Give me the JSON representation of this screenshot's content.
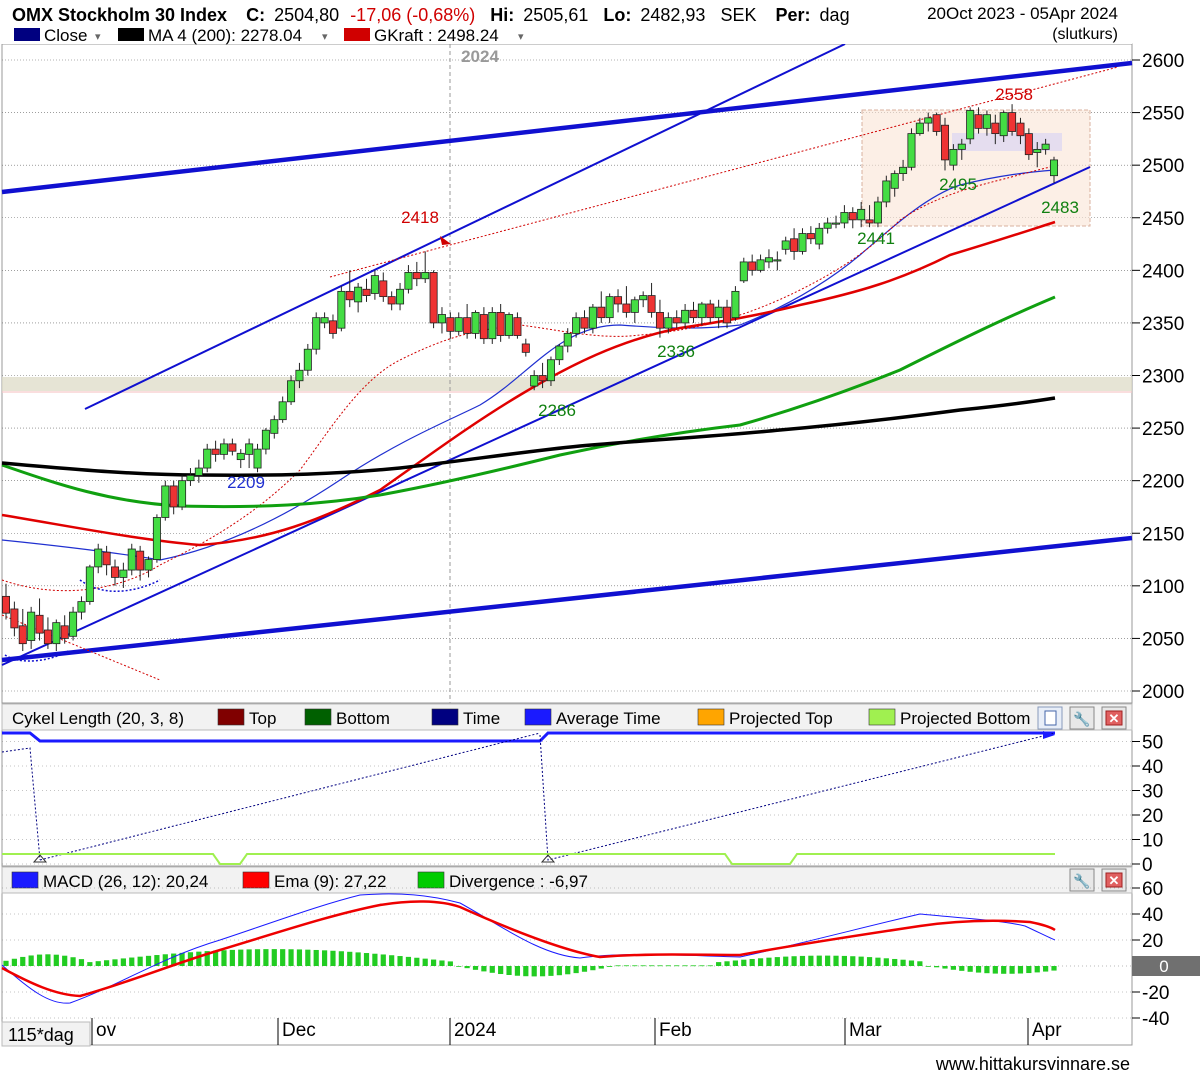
{
  "header": {
    "index_name": "OMX Stockholm 30 Index",
    "close_label": "C:",
    "close_value": "2504,80",
    "change": "-17,06 (-0,68%)",
    "hi_label": "Hi:",
    "hi_value": "2505,61",
    "lo_label": "Lo:",
    "lo_value": "2482,93",
    "currency": "SEK",
    "period_label": "Per:",
    "period_value": "dag",
    "date_range": "20Oct 2023 - 05Apr 2024",
    "price_basis": "(slutkurs)"
  },
  "legend": [
    {
      "label": "Close",
      "color": "#000080",
      "dropdown": true
    },
    {
      "label": "MA 4 (200): 2278.04",
      "color": "#000000",
      "dropdown": true
    },
    {
      "label": "GKraft : 2498.24",
      "color": "#d00000",
      "dropdown": true
    }
  ],
  "year_marker": "2024",
  "annotations": {
    "price_2418": "2418",
    "price_2558": "2558",
    "price_2495": "2495",
    "price_2483": "2483",
    "price_2441": "2441",
    "price_2336": "2336",
    "price_2286": "2286",
    "price_2209": "2209"
  },
  "cycle_panel": {
    "title": "Cykel Length (20, 3, 8)",
    "legend": [
      {
        "label": "Top",
        "color": "#800000"
      },
      {
        "label": "Bottom",
        "color": "#006000"
      },
      {
        "label": "Time",
        "color": "#000080"
      },
      {
        "label": "Average Time",
        "color": "#1a1aff"
      },
      {
        "label": "Projected Top",
        "color": "#ffa500"
      },
      {
        "label": "Projected Bottom",
        "color": "#a0f050"
      }
    ],
    "y_ticks": [
      "50",
      "40",
      "30",
      "20",
      "10",
      "0"
    ]
  },
  "macd_panel": {
    "legend": [
      {
        "label": "MACD (26, 12): 20,24",
        "color": "#1a1aff"
      },
      {
        "label": "Ema (9): 27,22",
        "color": "#ff0000"
      },
      {
        "label": "Divergence : -6,97",
        "color": "#00cc00"
      }
    ],
    "y_ticks": [
      "60",
      "40",
      "20",
      "-20",
      "-40"
    ],
    "zero_label": "0"
  },
  "x_axis": {
    "labels": [
      "ov",
      "Dec",
      "2024",
      "Feb",
      "Mar",
      "Apr"
    ],
    "timeframe": "115*dag"
  },
  "watermark": "www.hittakursvinnare.se",
  "chart_data": {
    "type": "candlestick",
    "price_axis": {
      "ticks": [
        2000,
        2050,
        2100,
        2150,
        2200,
        2250,
        2300,
        2350,
        2400,
        2450,
        2500,
        2550,
        2600
      ],
      "ylim": [
        1980,
        2615
      ]
    },
    "price_axis_labels": [
      "2000",
      "2050",
      "2100",
      "2150",
      "2200",
      "2250",
      "2300",
      "2350",
      "2400",
      "2450",
      "2500",
      "2550",
      "2600"
    ],
    "x_period": [
      "2023-10-20",
      "2024-04-05"
    ],
    "candles": [
      {
        "o": 2090,
        "h": 2102,
        "l": 2068,
        "c": 2074
      },
      {
        "o": 2078,
        "h": 2085,
        "l": 2052,
        "c": 2060
      },
      {
        "o": 2062,
        "h": 2078,
        "l": 2038,
        "c": 2045
      },
      {
        "o": 2048,
        "h": 2080,
        "l": 2040,
        "c": 2075
      },
      {
        "o": 2072,
        "h": 2088,
        "l": 2048,
        "c": 2055
      },
      {
        "o": 2058,
        "h": 2070,
        "l": 2040,
        "c": 2045
      },
      {
        "o": 2045,
        "h": 2068,
        "l": 2038,
        "c": 2065
      },
      {
        "o": 2062,
        "h": 2072,
        "l": 2045,
        "c": 2050
      },
      {
        "o": 2052,
        "h": 2080,
        "l": 2048,
        "c": 2075
      },
      {
        "o": 2075,
        "h": 2090,
        "l": 2068,
        "c": 2085
      },
      {
        "o": 2085,
        "h": 2120,
        "l": 2082,
        "c": 2118
      },
      {
        "o": 2118,
        "h": 2140,
        "l": 2112,
        "c": 2135
      },
      {
        "o": 2132,
        "h": 2138,
        "l": 2110,
        "c": 2120
      },
      {
        "o": 2118,
        "h": 2125,
        "l": 2100,
        "c": 2108
      },
      {
        "o": 2108,
        "h": 2122,
        "l": 2098,
        "c": 2115
      },
      {
        "o": 2115,
        "h": 2140,
        "l": 2110,
        "c": 2135
      },
      {
        "o": 2133,
        "h": 2138,
        "l": 2105,
        "c": 2115
      },
      {
        "o": 2115,
        "h": 2128,
        "l": 2108,
        "c": 2125
      },
      {
        "o": 2125,
        "h": 2168,
        "l": 2122,
        "c": 2165
      },
      {
        "o": 2165,
        "h": 2200,
        "l": 2162,
        "c": 2195
      },
      {
        "o": 2195,
        "h": 2200,
        "l": 2168,
        "c": 2175
      },
      {
        "o": 2175,
        "h": 2205,
        "l": 2172,
        "c": 2200
      },
      {
        "o": 2200,
        "h": 2212,
        "l": 2195,
        "c": 2205
      },
      {
        "o": 2205,
        "h": 2220,
        "l": 2198,
        "c": 2212
      },
      {
        "o": 2212,
        "h": 2235,
        "l": 2208,
        "c": 2230
      },
      {
        "o": 2230,
        "h": 2238,
        "l": 2218,
        "c": 2225
      },
      {
        "o": 2225,
        "h": 2240,
        "l": 2220,
        "c": 2235
      },
      {
        "o": 2235,
        "h": 2240,
        "l": 2224,
        "c": 2228
      },
      {
        "o": 2220,
        "h": 2230,
        "l": 2212,
        "c": 2226
      },
      {
        "o": 2225,
        "h": 2240,
        "l": 2212,
        "c": 2235
      },
      {
        "o": 2212,
        "h": 2235,
        "l": 2208,
        "c": 2230
      },
      {
        "o": 2230,
        "h": 2250,
        "l": 2225,
        "c": 2248
      },
      {
        "o": 2245,
        "h": 2262,
        "l": 2240,
        "c": 2258
      },
      {
        "o": 2258,
        "h": 2280,
        "l": 2255,
        "c": 2275
      },
      {
        "o": 2275,
        "h": 2300,
        "l": 2272,
        "c": 2295
      },
      {
        "o": 2295,
        "h": 2312,
        "l": 2288,
        "c": 2305
      },
      {
        "o": 2305,
        "h": 2330,
        "l": 2300,
        "c": 2325
      },
      {
        "o": 2325,
        "h": 2360,
        "l": 2320,
        "c": 2355
      },
      {
        "o": 2350,
        "h": 2360,
        "l": 2345,
        "c": 2355
      },
      {
        "o": 2352,
        "h": 2358,
        "l": 2335,
        "c": 2340
      },
      {
        "o": 2345,
        "h": 2385,
        "l": 2342,
        "c": 2380
      },
      {
        "o": 2380,
        "h": 2400,
        "l": 2365,
        "c": 2372
      },
      {
        "o": 2370,
        "h": 2388,
        "l": 2360,
        "c": 2384
      },
      {
        "o": 2382,
        "h": 2392,
        "l": 2370,
        "c": 2376
      },
      {
        "o": 2378,
        "h": 2400,
        "l": 2372,
        "c": 2395
      },
      {
        "o": 2390,
        "h": 2398,
        "l": 2370,
        "c": 2375
      },
      {
        "o": 2375,
        "h": 2380,
        "l": 2362,
        "c": 2368
      },
      {
        "o": 2368,
        "h": 2388,
        "l": 2362,
        "c": 2382
      },
      {
        "o": 2382,
        "h": 2405,
        "l": 2378,
        "c": 2398
      },
      {
        "o": 2398,
        "h": 2408,
        "l": 2385,
        "c": 2392
      },
      {
        "o": 2392,
        "h": 2418,
        "l": 2388,
        "c": 2398
      },
      {
        "o": 2398,
        "h": 2400,
        "l": 2345,
        "c": 2350
      },
      {
        "o": 2350,
        "h": 2365,
        "l": 2340,
        "c": 2358
      },
      {
        "o": 2355,
        "h": 2360,
        "l": 2335,
        "c": 2342
      },
      {
        "o": 2342,
        "h": 2360,
        "l": 2338,
        "c": 2355
      },
      {
        "o": 2355,
        "h": 2368,
        "l": 2335,
        "c": 2340
      },
      {
        "o": 2340,
        "h": 2362,
        "l": 2335,
        "c": 2360
      },
      {
        "o": 2358,
        "h": 2365,
        "l": 2330,
        "c": 2335
      },
      {
        "o": 2335,
        "h": 2365,
        "l": 2330,
        "c": 2360
      },
      {
        "o": 2360,
        "h": 2368,
        "l": 2332,
        "c": 2338
      },
      {
        "o": 2338,
        "h": 2360,
        "l": 2335,
        "c": 2358
      },
      {
        "o": 2355,
        "h": 2360,
        "l": 2335,
        "c": 2338
      },
      {
        "o": 2330,
        "h": 2335,
        "l": 2318,
        "c": 2322
      },
      {
        "o": 2290,
        "h": 2305,
        "l": 2286,
        "c": 2300
      },
      {
        "o": 2300,
        "h": 2312,
        "l": 2288,
        "c": 2295
      },
      {
        "o": 2295,
        "h": 2318,
        "l": 2290,
        "c": 2315
      },
      {
        "o": 2315,
        "h": 2330,
        "l": 2310,
        "c": 2328
      },
      {
        "o": 2328,
        "h": 2345,
        "l": 2322,
        "c": 2340
      },
      {
        "o": 2340,
        "h": 2360,
        "l": 2336,
        "c": 2355
      },
      {
        "o": 2355,
        "h": 2362,
        "l": 2340,
        "c": 2345
      },
      {
        "o": 2345,
        "h": 2368,
        "l": 2340,
        "c": 2365
      },
      {
        "o": 2365,
        "h": 2380,
        "l": 2350,
        "c": 2355
      },
      {
        "o": 2355,
        "h": 2378,
        "l": 2350,
        "c": 2375
      },
      {
        "o": 2375,
        "h": 2382,
        "l": 2360,
        "c": 2368
      },
      {
        "o": 2368,
        "h": 2385,
        "l": 2355,
        "c": 2360
      },
      {
        "o": 2360,
        "h": 2375,
        "l": 2350,
        "c": 2372
      },
      {
        "o": 2372,
        "h": 2380,
        "l": 2365,
        "c": 2376
      },
      {
        "o": 2376,
        "h": 2388,
        "l": 2355,
        "c": 2360
      },
      {
        "o": 2360,
        "h": 2372,
        "l": 2336,
        "c": 2345
      },
      {
        "o": 2345,
        "h": 2360,
        "l": 2340,
        "c": 2355
      },
      {
        "o": 2355,
        "h": 2362,
        "l": 2345,
        "c": 2350
      },
      {
        "o": 2350,
        "h": 2368,
        "l": 2345,
        "c": 2362
      },
      {
        "o": 2362,
        "h": 2370,
        "l": 2350,
        "c": 2355
      },
      {
        "o": 2355,
        "h": 2370,
        "l": 2348,
        "c": 2368
      },
      {
        "o": 2368,
        "h": 2372,
        "l": 2350,
        "c": 2355
      },
      {
        "o": 2355,
        "h": 2372,
        "l": 2345,
        "c": 2365
      },
      {
        "o": 2365,
        "h": 2372,
        "l": 2345,
        "c": 2350
      },
      {
        "o": 2355,
        "h": 2385,
        "l": 2352,
        "c": 2380
      },
      {
        "o": 2390,
        "h": 2412,
        "l": 2388,
        "c": 2408
      },
      {
        "o": 2408,
        "h": 2415,
        "l": 2395,
        "c": 2400
      },
      {
        "o": 2400,
        "h": 2415,
        "l": 2398,
        "c": 2410
      },
      {
        "o": 2408,
        "h": 2420,
        "l": 2402,
        "c": 2412
      },
      {
        "o": 2410,
        "h": 2418,
        "l": 2400,
        "c": 2410
      },
      {
        "o": 2420,
        "h": 2432,
        "l": 2415,
        "c": 2428
      },
      {
        "o": 2430,
        "h": 2440,
        "l": 2410,
        "c": 2418
      },
      {
        "o": 2418,
        "h": 2440,
        "l": 2415,
        "c": 2435
      },
      {
        "o": 2435,
        "h": 2442,
        "l": 2425,
        "c": 2430
      },
      {
        "o": 2425,
        "h": 2445,
        "l": 2420,
        "c": 2440
      },
      {
        "o": 2440,
        "h": 2450,
        "l": 2435,
        "c": 2445
      },
      {
        "o": 2445,
        "h": 2452,
        "l": 2440,
        "c": 2445
      },
      {
        "o": 2445,
        "h": 2462,
        "l": 2440,
        "c": 2455
      },
      {
        "o": 2455,
        "h": 2460,
        "l": 2440,
        "c": 2448
      },
      {
        "o": 2448,
        "h": 2465,
        "l": 2441,
        "c": 2458
      },
      {
        "o": 2448,
        "h": 2462,
        "l": 2441,
        "c": 2445
      },
      {
        "o": 2445,
        "h": 2470,
        "l": 2441,
        "c": 2465
      },
      {
        "o": 2465,
        "h": 2490,
        "l": 2460,
        "c": 2485
      },
      {
        "o": 2478,
        "h": 2495,
        "l": 2470,
        "c": 2492
      },
      {
        "o": 2492,
        "h": 2505,
        "l": 2485,
        "c": 2498
      },
      {
        "o": 2498,
        "h": 2535,
        "l": 2495,
        "c": 2530
      },
      {
        "o": 2530,
        "h": 2545,
        "l": 2528,
        "c": 2540
      },
      {
        "o": 2540,
        "h": 2550,
        "l": 2532,
        "c": 2545
      },
      {
        "o": 2548,
        "h": 2550,
        "l": 2528,
        "c": 2532
      },
      {
        "o": 2538,
        "h": 2545,
        "l": 2495,
        "c": 2505
      },
      {
        "o": 2500,
        "h": 2520,
        "l": 2495,
        "c": 2515
      },
      {
        "o": 2515,
        "h": 2525,
        "l": 2505,
        "c": 2520
      },
      {
        "o": 2525,
        "h": 2555,
        "l": 2520,
        "c": 2552
      },
      {
        "o": 2548,
        "h": 2555,
        "l": 2530,
        "c": 2535
      },
      {
        "o": 2535,
        "h": 2552,
        "l": 2528,
        "c": 2548
      },
      {
        "o": 2540,
        "h": 2548,
        "l": 2520,
        "c": 2530
      },
      {
        "o": 2528,
        "h": 2552,
        "l": 2522,
        "c": 2550
      },
      {
        "o": 2550,
        "h": 2558,
        "l": 2528,
        "c": 2532
      },
      {
        "o": 2540,
        "h": 2545,
        "l": 2520,
        "c": 2528
      },
      {
        "o": 2530,
        "h": 2535,
        "l": 2505,
        "c": 2510
      },
      {
        "o": 2512,
        "h": 2522,
        "l": 2498,
        "c": 2515
      },
      {
        "o": 2515,
        "h": 2525,
        "l": 2510,
        "c": 2520
      },
      {
        "o": 2490,
        "h": 2508,
        "l": 2483,
        "c": 2505
      }
    ],
    "series": [
      {
        "name": "MA 4 (200)",
        "color": "#000000",
        "values_at_fraction": [
          [
            0,
            2215
          ],
          [
            0.1,
            2208
          ],
          [
            0.2,
            2205
          ],
          [
            0.3,
            2205
          ],
          [
            0.4,
            2212
          ],
          [
            0.5,
            2225
          ],
          [
            0.6,
            2234
          ],
          [
            0.7,
            2240
          ],
          [
            0.8,
            2250
          ],
          [
            0.9,
            2265
          ],
          [
            1.0,
            2278
          ]
        ]
      },
      {
        "name": "GKraft",
        "color": "#d00000",
        "values_at_fraction": [
          [
            0,
            2165
          ],
          [
            0.1,
            2155
          ],
          [
            0.2,
            2148
          ],
          [
            0.3,
            2165
          ],
          [
            0.4,
            2205
          ],
          [
            0.5,
            2255
          ],
          [
            0.6,
            2315
          ],
          [
            0.7,
            2340
          ],
          [
            0.8,
            2370
          ],
          [
            0.9,
            2408
          ],
          [
            1.0,
            2445
          ]
        ]
      }
    ],
    "macd": {
      "macd_end": 20.24,
      "ema_end": 27.22,
      "divergence_end": -6.97,
      "ylim": [
        -45,
        65
      ]
    }
  }
}
